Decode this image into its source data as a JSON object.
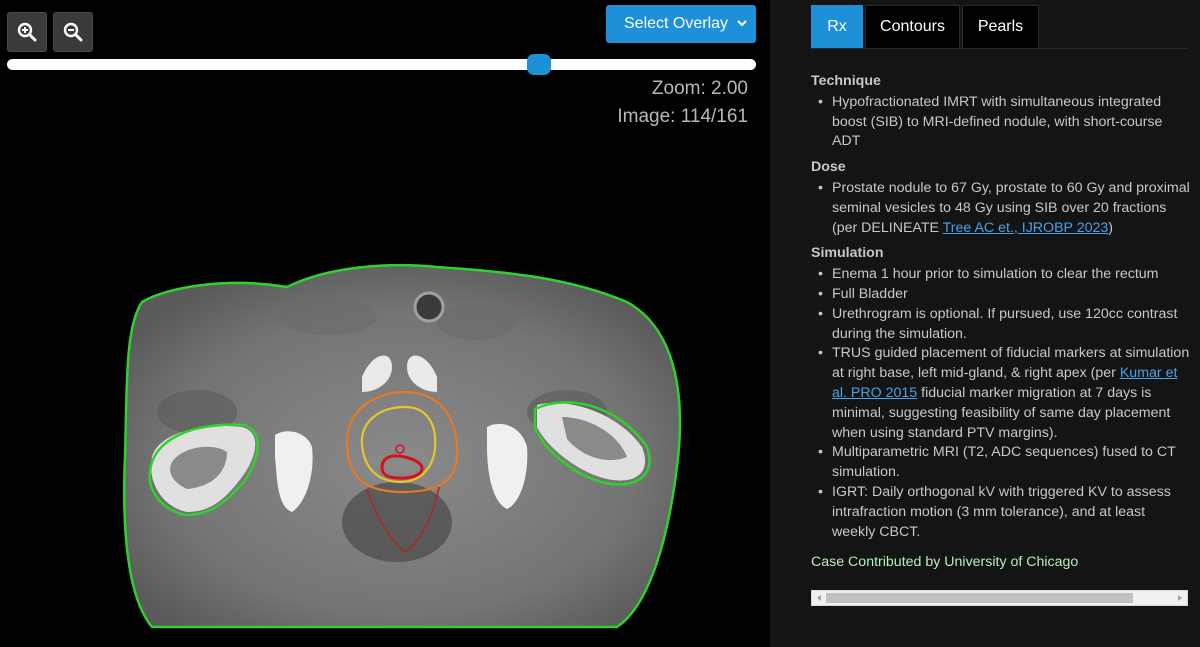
{
  "viewer": {
    "zoom_in_label": "Zoom in",
    "zoom_out_label": "Zoom out",
    "overlay_select": "Select Overlay",
    "zoom_text": "Zoom: 2.00",
    "image_text": "Image: 114/161",
    "slider_fraction": 0.71,
    "contour_colors": {
      "external": "#2ed12e",
      "ptv_orange": "#e87a24",
      "prostate_yellow": "#e6c628",
      "nodule_red": "#d0141c",
      "rectum_darkred": "#a03020"
    }
  },
  "panel": {
    "tabs": [
      {
        "label": "Rx",
        "active": true
      },
      {
        "label": "Contours",
        "active": false
      },
      {
        "label": "Pearls",
        "active": false
      }
    ],
    "sections": {
      "technique": {
        "title": "Technique",
        "items": [
          "Hypofractionated IMRT with simultaneous integrated boost (SIB) to MRI-defined nodule, with short-course ADT"
        ]
      },
      "dose": {
        "title": "Dose",
        "item_text": "Prostate nodule to 67 Gy, prostate to 60 Gy and proximal seminal vesicles to 48 Gy using SIB over 20 fractions (per DELINEATE ",
        "item_link": "Tree AC et., IJROBP 2023",
        "item_end": ")"
      },
      "simulation": {
        "title": "Simulation",
        "item1": "Enema 1 hour prior to simulation to clear the rectum",
        "item2": "Full Bladder",
        "item3": "Urethrogram is optional. If pursued, use 120cc contrast during the simulation.",
        "item4_pre": "TRUS guided placement of fiducial markers at simulation at right base, left mid-gland, & right apex (per ",
        "item4_link": "Kumar et al. PRO 2015",
        "item4_post": " fiducial marker migration at 7 days is minimal, suggesting feasibility of same day placement when using standard PTV margins).",
        "item5": "Multiparametric MRI (T2, ADC sequences) fused to CT simulation.",
        "item6": "IGRT: Daily orthogonal kV with triggered KV to assess intrafraction motion (3 mm tolerance), and at least weekly CBCT."
      }
    },
    "contributor": "Case Contributed by University of Chicago"
  }
}
